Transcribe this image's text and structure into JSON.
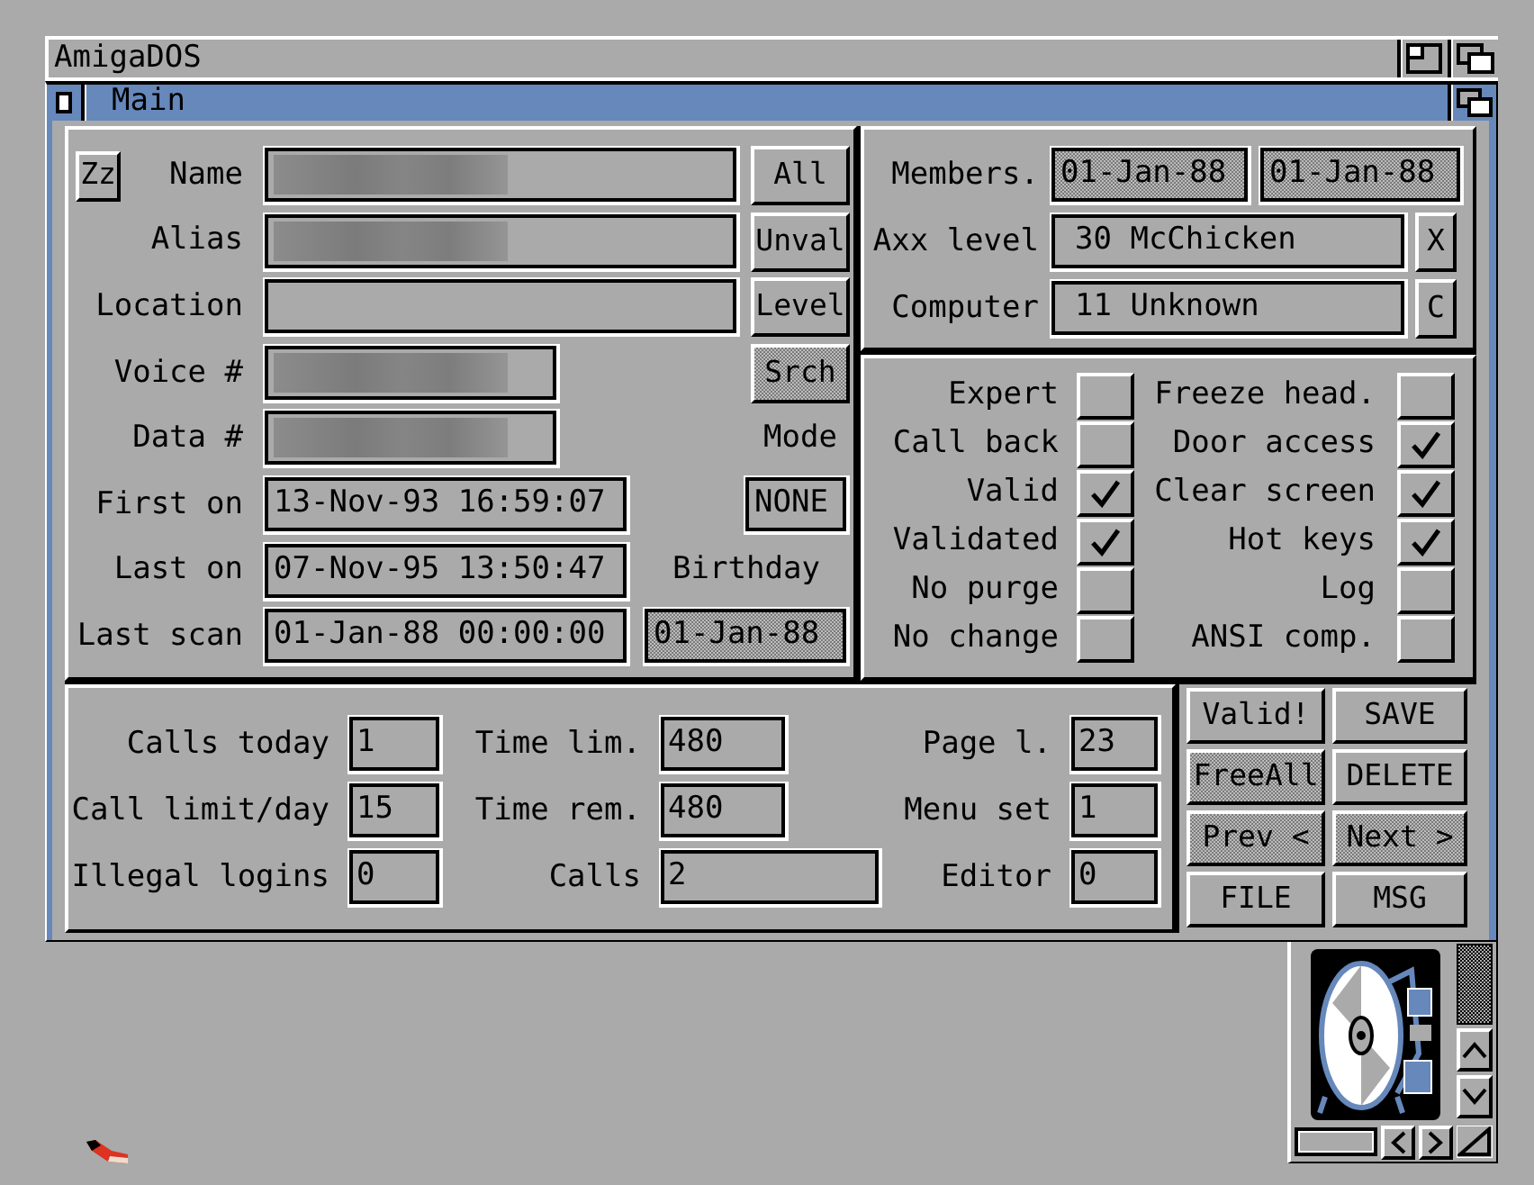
{
  "screen_window": {
    "title": "AmigaDOS"
  },
  "window": {
    "title": "Main"
  },
  "user_panel": {
    "sleep_button": {
      "label": "Zz"
    },
    "name_fields": [
      {
        "label": "Name",
        "blurred": true
      },
      {
        "label": "Alias",
        "blurred": true
      },
      {
        "label": "Location",
        "blurred": false
      }
    ],
    "phone_fields": [
      {
        "label": "Voice #",
        "blurred": true
      },
      {
        "label": "Data #",
        "blurred": true
      }
    ],
    "date_fields": [
      {
        "label": "First on",
        "value": "13-Nov-93 16:59:07"
      },
      {
        "label": "Last on",
        "value": "07-Nov-95 13:50:47"
      },
      {
        "label": "Last scan",
        "value": "01-Jan-88 00:00:00"
      }
    ],
    "filter_buttons": [
      {
        "label": "All",
        "disabled": false
      },
      {
        "label": "Unval",
        "disabled": false
      },
      {
        "label": "Level",
        "disabled": false
      },
      {
        "label": "Srch",
        "disabled": true
      }
    ],
    "mode": {
      "label": "Mode",
      "value": "NONE"
    },
    "birthday": {
      "label": "Birthday",
      "value": "01-Jan-88",
      "disabled": true
    }
  },
  "access_panel": {
    "members": {
      "label": "Members.",
      "dates": [
        {
          "value": "01-Jan-88",
          "disabled": true
        },
        {
          "value": "01-Jan-88",
          "disabled": true
        }
      ]
    },
    "selectors": [
      {
        "label": "Axx level",
        "value": "30 McChicken",
        "button": {
          "label": "X"
        }
      },
      {
        "label": "Computer",
        "value": "11 Unknown",
        "button": {
          "label": "C"
        }
      }
    ]
  },
  "flags": [
    {
      "label": "Expert",
      "checked": false
    },
    {
      "label": "Call back",
      "checked": false
    },
    {
      "label": "Valid",
      "checked": true
    },
    {
      "label": "Validated",
      "checked": true
    },
    {
      "label": "No purge",
      "checked": false
    },
    {
      "label": "No change",
      "checked": false
    },
    {
      "label": "Freeze head.",
      "checked": false
    },
    {
      "label": "Door access",
      "checked": true
    },
    {
      "label": "Clear screen",
      "checked": true
    },
    {
      "label": "Hot keys",
      "checked": true
    },
    {
      "label": "Log",
      "checked": false
    },
    {
      "label": "ANSI comp.",
      "checked": false
    }
  ],
  "stats": {
    "counters": [
      {
        "label": "Calls today",
        "value": "1"
      },
      {
        "label": "Time lim.",
        "value": "480"
      },
      {
        "label": "Page l.",
        "value": "23"
      },
      {
        "label": "Call limit/day",
        "value": "15"
      },
      {
        "label": "Time rem.",
        "value": "480"
      },
      {
        "label": "Menu set",
        "value": "1"
      },
      {
        "label": "Illegal logins",
        "value": "0"
      },
      {
        "label": "Calls",
        "value": "2"
      },
      {
        "label": "Editor",
        "value": "0"
      }
    ]
  },
  "action_buttons": [
    {
      "label": "Valid!",
      "disabled": false
    },
    {
      "label": "SAVE",
      "disabled": false
    },
    {
      "label": "FreeAll",
      "disabled": true
    },
    {
      "label": "DELETE",
      "disabled": false
    },
    {
      "label": "Prev <",
      "disabled": true
    },
    {
      "label": "Next >",
      "disabled": true
    },
    {
      "label": "FILE",
      "disabled": false
    },
    {
      "label": "MSG",
      "disabled": false
    }
  ]
}
